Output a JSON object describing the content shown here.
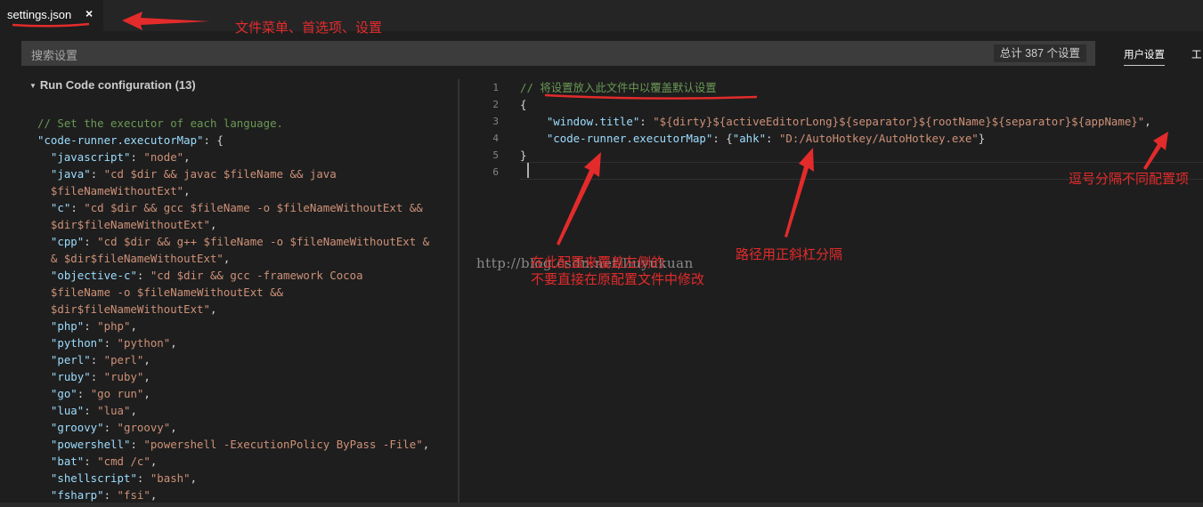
{
  "tab": {
    "label": "settings.json",
    "close": "×"
  },
  "search": {
    "placeholder": "搜索设置",
    "count": "总计 387 个设置"
  },
  "scopes": {
    "user": "用户设置",
    "workspace": "工"
  },
  "left": {
    "section_title": "Run Code configuration (13)",
    "lines": [
      [
        {
          "t": "cmt",
          "v": "// Set the executor of each language."
        }
      ],
      [
        {
          "t": "key",
          "v": "\"code-runner.executorMap\""
        },
        {
          "t": "punct",
          "v": ": {"
        }
      ],
      [
        {
          "t": "punct",
          "v": "  "
        },
        {
          "t": "key",
          "v": "\"javascript\""
        },
        {
          "t": "punct",
          "v": ": "
        },
        {
          "t": "str",
          "v": "\"node\""
        },
        {
          "t": "punct",
          "v": ","
        }
      ],
      [
        {
          "t": "punct",
          "v": "  "
        },
        {
          "t": "key",
          "v": "\"java\""
        },
        {
          "t": "punct",
          "v": ": "
        },
        {
          "t": "str",
          "v": "\"cd $dir && javac $fileName && java"
        }
      ],
      [
        {
          "t": "str",
          "v": "  $fileNameWithoutExt\""
        },
        {
          "t": "punct",
          "v": ","
        }
      ],
      [
        {
          "t": "punct",
          "v": "  "
        },
        {
          "t": "key",
          "v": "\"c\""
        },
        {
          "t": "punct",
          "v": ": "
        },
        {
          "t": "str",
          "v": "\"cd $dir && gcc $fileName -o $fileNameWithoutExt &&"
        }
      ],
      [
        {
          "t": "str",
          "v": "  $dir$fileNameWithoutExt\""
        },
        {
          "t": "punct",
          "v": ","
        }
      ],
      [
        {
          "t": "punct",
          "v": "  "
        },
        {
          "t": "key",
          "v": "\"cpp\""
        },
        {
          "t": "punct",
          "v": ": "
        },
        {
          "t": "str",
          "v": "\"cd $dir && g++ $fileName -o $fileNameWithoutExt &"
        }
      ],
      [
        {
          "t": "str",
          "v": "  & $dir$fileNameWithoutExt\""
        },
        {
          "t": "punct",
          "v": ","
        }
      ],
      [
        {
          "t": "punct",
          "v": "  "
        },
        {
          "t": "key",
          "v": "\"objective-c\""
        },
        {
          "t": "punct",
          "v": ": "
        },
        {
          "t": "str",
          "v": "\"cd $dir && gcc -framework Cocoa"
        }
      ],
      [
        {
          "t": "str",
          "v": "  $fileName -o $fileNameWithoutExt &&"
        }
      ],
      [
        {
          "t": "str",
          "v": "  $dir$fileNameWithoutExt\""
        },
        {
          "t": "punct",
          "v": ","
        }
      ],
      [
        {
          "t": "punct",
          "v": "  "
        },
        {
          "t": "key",
          "v": "\"php\""
        },
        {
          "t": "punct",
          "v": ": "
        },
        {
          "t": "str",
          "v": "\"php\""
        },
        {
          "t": "punct",
          "v": ","
        }
      ],
      [
        {
          "t": "punct",
          "v": "  "
        },
        {
          "t": "key",
          "v": "\"python\""
        },
        {
          "t": "punct",
          "v": ": "
        },
        {
          "t": "str",
          "v": "\"python\""
        },
        {
          "t": "punct",
          "v": ","
        }
      ],
      [
        {
          "t": "punct",
          "v": "  "
        },
        {
          "t": "key",
          "v": "\"perl\""
        },
        {
          "t": "punct",
          "v": ": "
        },
        {
          "t": "str",
          "v": "\"perl\""
        },
        {
          "t": "punct",
          "v": ","
        }
      ],
      [
        {
          "t": "punct",
          "v": "  "
        },
        {
          "t": "key",
          "v": "\"ruby\""
        },
        {
          "t": "punct",
          "v": ": "
        },
        {
          "t": "str",
          "v": "\"ruby\""
        },
        {
          "t": "punct",
          "v": ","
        }
      ],
      [
        {
          "t": "punct",
          "v": "  "
        },
        {
          "t": "key",
          "v": "\"go\""
        },
        {
          "t": "punct",
          "v": ": "
        },
        {
          "t": "str",
          "v": "\"go run\""
        },
        {
          "t": "punct",
          "v": ","
        }
      ],
      [
        {
          "t": "punct",
          "v": "  "
        },
        {
          "t": "key",
          "v": "\"lua\""
        },
        {
          "t": "punct",
          "v": ": "
        },
        {
          "t": "str",
          "v": "\"lua\""
        },
        {
          "t": "punct",
          "v": ","
        }
      ],
      [
        {
          "t": "punct",
          "v": "  "
        },
        {
          "t": "key",
          "v": "\"groovy\""
        },
        {
          "t": "punct",
          "v": ": "
        },
        {
          "t": "str",
          "v": "\"groovy\""
        },
        {
          "t": "punct",
          "v": ","
        }
      ],
      [
        {
          "t": "punct",
          "v": "  "
        },
        {
          "t": "key",
          "v": "\"powershell\""
        },
        {
          "t": "punct",
          "v": ": "
        },
        {
          "t": "str",
          "v": "\"powershell -ExecutionPolicy ByPass -File\""
        },
        {
          "t": "punct",
          "v": ","
        }
      ],
      [
        {
          "t": "punct",
          "v": "  "
        },
        {
          "t": "key",
          "v": "\"bat\""
        },
        {
          "t": "punct",
          "v": ": "
        },
        {
          "t": "str",
          "v": "\"cmd /c\""
        },
        {
          "t": "punct",
          "v": ","
        }
      ],
      [
        {
          "t": "punct",
          "v": "  "
        },
        {
          "t": "key",
          "v": "\"shellscript\""
        },
        {
          "t": "punct",
          "v": ": "
        },
        {
          "t": "str",
          "v": "\"bash\""
        },
        {
          "t": "punct",
          "v": ","
        }
      ],
      [
        {
          "t": "punct",
          "v": "  "
        },
        {
          "t": "key",
          "v": "\"fsharp\""
        },
        {
          "t": "punct",
          "v": ": "
        },
        {
          "t": "str",
          "v": "\"fsi\""
        },
        {
          "t": "punct",
          "v": ","
        }
      ]
    ]
  },
  "right": {
    "line_numbers": [
      "1",
      "2",
      "3",
      "4",
      "5",
      "6"
    ],
    "lines": [
      [
        {
          "t": "cmt",
          "v": "// 将设置放入此文件中以覆盖默认设置"
        }
      ],
      [
        {
          "t": "punct",
          "v": "{"
        }
      ],
      [
        {
          "t": "punct",
          "v": "    "
        },
        {
          "t": "key",
          "v": "\"window.title\""
        },
        {
          "t": "punct",
          "v": ": "
        },
        {
          "t": "str",
          "v": "\"${dirty}${activeEditorLong}${separator}${rootName}${separator}${appName}\""
        },
        {
          "t": "punct",
          "v": ","
        }
      ],
      [
        {
          "t": "punct",
          "v": "    "
        },
        {
          "t": "key",
          "v": "\"code-runner.executorMap\""
        },
        {
          "t": "punct",
          "v": ": {"
        },
        {
          "t": "key",
          "v": "\"ahk\""
        },
        {
          "t": "punct",
          "v": ": "
        },
        {
          "t": "str",
          "v": "\"D:/AutoHotkey/AutoHotkey.exe\""
        },
        {
          "t": "punct",
          "v": "}"
        }
      ],
      [
        {
          "t": "punct",
          "v": "}"
        }
      ],
      [
        {
          "t": "punct",
          "v": ""
        }
      ]
    ]
  },
  "annotations": {
    "file_menu": "文件菜单、首选项、设置",
    "comma": "逗号分隔不同配置项",
    "path": "路径用正斜杠分隔",
    "override_1": "在此配置来覆盖左侧的",
    "override_2": "不要直接在原配置文件中修改",
    "watermark": "http://blog.csdn.net/liuyukuan"
  },
  "colors": {
    "annotation": "#e32b2b",
    "comment": "#6a9955",
    "key": "#9cdcfe",
    "string": "#ce9178"
  }
}
